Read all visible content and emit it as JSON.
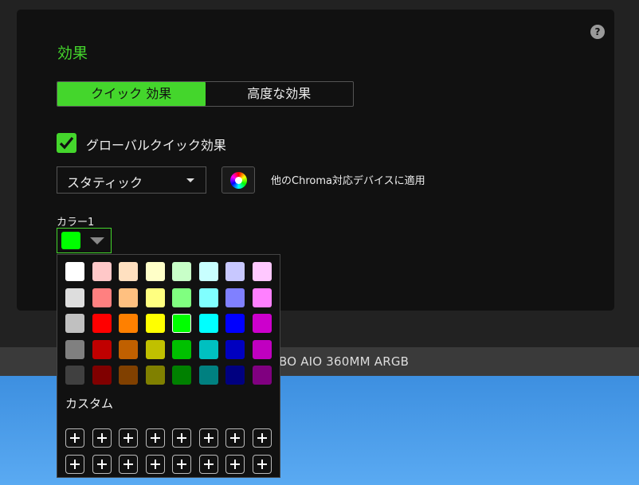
{
  "effects": {
    "title": "効果",
    "help_label": "?",
    "tabs": [
      {
        "label": "クイック 効果",
        "active": true
      },
      {
        "label": "高度な効果",
        "active": false
      }
    ],
    "global_quick_effect": {
      "label": "グローバルクイック効果",
      "checked": true
    },
    "effect_select": {
      "value": "スタティック"
    },
    "chroma_apply": {
      "label": "他のChroma対応デバイスに適用",
      "icon": "color-wheel-icon"
    },
    "color1": {
      "label": "カラー1",
      "value": "#00ff00"
    }
  },
  "colors": {
    "accent": "#44d62c",
    "panel": "#111111",
    "background": "#222222"
  },
  "color_popup": {
    "swatches": [
      [
        "#ffffff",
        "#ffc8c8",
        "#ffe0c0",
        "#ffffc8",
        "#c8ffc8",
        "#c8ffff",
        "#c8c8ff",
        "#ffc8ff"
      ],
      [
        "#dddddd",
        "#ff8080",
        "#ffc080",
        "#ffff80",
        "#80ff80",
        "#80ffff",
        "#8080ff",
        "#ff80ff"
      ],
      [
        "#c0c0c0",
        "#ff0000",
        "#ff8000",
        "#ffff00",
        "#00ff00",
        "#00ffff",
        "#0000ff",
        "#cc00cc"
      ],
      [
        "#808080",
        "#c00000",
        "#c06000",
        "#c0c000",
        "#00c000",
        "#00c0c0",
        "#0000c0",
        "#c000c0"
      ],
      [
        "#404040",
        "#800000",
        "#804000",
        "#808000",
        "#008000",
        "#008080",
        "#000080",
        "#800080"
      ]
    ],
    "selected": "#00ff00",
    "custom_label": "カスタム",
    "custom_slots": 16
  },
  "device": {
    "name": "BO AIO 360MM ARGB"
  }
}
